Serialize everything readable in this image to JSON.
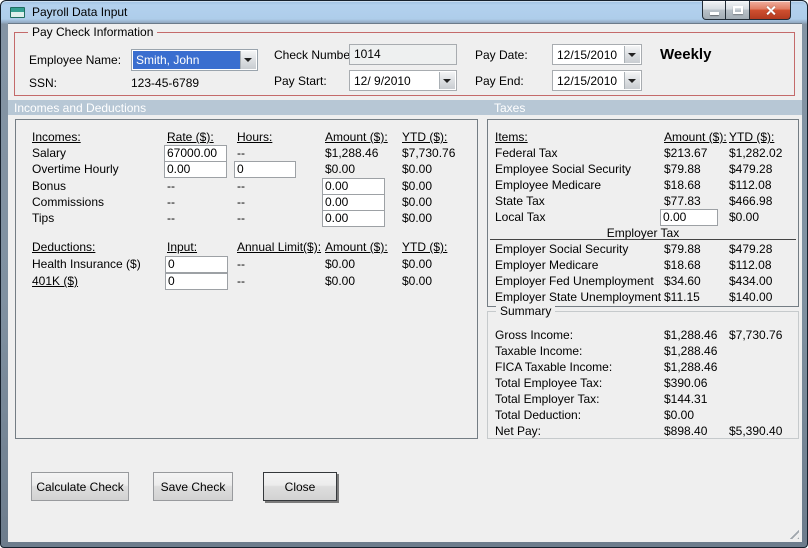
{
  "window": {
    "title": "Payroll Data Input"
  },
  "icons": {
    "app": "form-window",
    "dropdown": "chevron-down",
    "minimize": "underscore-bar",
    "maximize": "square-outline",
    "close": "x-cross",
    "resize_grip": "diagonal-lines"
  },
  "colors": {
    "section_header_bg": "#b7c7d5",
    "paycheck_border": "#c46a6a",
    "selection_blue": "#3a6ecf",
    "close_button_red": "#d05030",
    "form_bg": "#efefef"
  },
  "paycheck": {
    "group_title": "Pay Check Information",
    "labels": {
      "employee_name": "Employee Name:",
      "ssn": "SSN:",
      "check_number": "Check Number:",
      "pay_start": "Pay Start:",
      "pay_date": "Pay Date:",
      "pay_end": "Pay End:"
    },
    "values": {
      "employee_name": "Smith, John",
      "ssn": "123-45-6789",
      "check_number": "1014",
      "pay_start": "12/ 9/2010",
      "pay_date": "12/15/2010",
      "pay_end": "12/15/2010"
    },
    "frequency": "Weekly"
  },
  "sections": {
    "left": "Incomes and Deductions",
    "right": "Taxes"
  },
  "incomes": {
    "headers": {
      "item": "Incomes:",
      "rate": "Rate ($):",
      "hours": "Hours:",
      "amount": "Amount ($):",
      "ytd": "YTD ($):"
    },
    "rows": [
      {
        "label": "Salary",
        "rate": "67000.00",
        "hours": "--",
        "amount": "$1,288.46",
        "ytd": "$7,730.76"
      },
      {
        "label": "Overtime Hourly",
        "rate": "0.00",
        "hours": "0",
        "amount": "$0.00",
        "ytd": "$0.00"
      },
      {
        "label": "Bonus",
        "rate": "--",
        "hours": "--",
        "amount": "0.00",
        "ytd": "$0.00"
      },
      {
        "label": "Commissions",
        "rate": "--",
        "hours": "--",
        "amount": "0.00",
        "ytd": "$0.00"
      },
      {
        "label": "Tips",
        "rate": "--",
        "hours": "--",
        "amount": "0.00",
        "ytd": "$0.00"
      }
    ]
  },
  "deductions": {
    "headers": {
      "item": "Deductions:",
      "input": "Input:",
      "annual_limit": "Annual Limit($):",
      "amount": "Amount ($):",
      "ytd": "YTD ($):"
    },
    "rows": [
      {
        "label": "Health Insurance  ($)",
        "input": "0",
        "annual_limit": "--",
        "amount": "$0.00",
        "ytd": "$0.00"
      },
      {
        "label": "401K  ($)",
        "input": "0",
        "annual_limit": "--",
        "amount": "$0.00",
        "ytd": "$0.00"
      }
    ]
  },
  "taxes": {
    "headers": {
      "item": "Items:",
      "amount": "Amount ($):",
      "ytd": "YTD ($):"
    },
    "employee_rows": [
      {
        "label": "Federal Tax",
        "amount": "$213.67",
        "ytd": "$1,282.02"
      },
      {
        "label": "Employee Social Security",
        "amount": "$79.88",
        "ytd": "$479.28"
      },
      {
        "label": "Employee Medicare",
        "amount": "$18.68",
        "ytd": "$112.08"
      },
      {
        "label": "State Tax",
        "amount": "$77.83",
        "ytd": "$466.98"
      },
      {
        "label": "Local Tax",
        "amount": "0.00",
        "ytd": "$0.00"
      }
    ],
    "employer_header": "Employer Tax",
    "employer_rows": [
      {
        "label": "Employer Social Security",
        "amount": "$79.88",
        "ytd": "$479.28"
      },
      {
        "label": "Employer Medicare",
        "amount": "$18.68",
        "ytd": "$112.08"
      },
      {
        "label": "Employer Fed Unemployment",
        "amount": "$34.60",
        "ytd": "$434.00"
      },
      {
        "label": "Employer State Unemployment",
        "amount": "$11.15",
        "ytd": "$140.00"
      }
    ]
  },
  "summary": {
    "group_title": "Summary",
    "rows": [
      {
        "label": "Gross Income:",
        "amount": "$1,288.46",
        "ytd": "$7,730.76"
      },
      {
        "label": "Taxable Income:",
        "amount": "$1,288.46",
        "ytd": ""
      },
      {
        "label": "FICA Taxable Income:",
        "amount": "$1,288.46",
        "ytd": ""
      },
      {
        "label": "Total Employee Tax:",
        "amount": "$390.06",
        "ytd": ""
      },
      {
        "label": "Total Employer Tax:",
        "amount": "$144.31",
        "ytd": ""
      },
      {
        "label": "Total Deduction:",
        "amount": "$0.00",
        "ytd": ""
      },
      {
        "label": "Net Pay:",
        "amount": "$898.40",
        "ytd": "$5,390.40"
      }
    ]
  },
  "buttons": {
    "calculate": "Calculate Check",
    "save": "Save Check",
    "close": "Close"
  }
}
